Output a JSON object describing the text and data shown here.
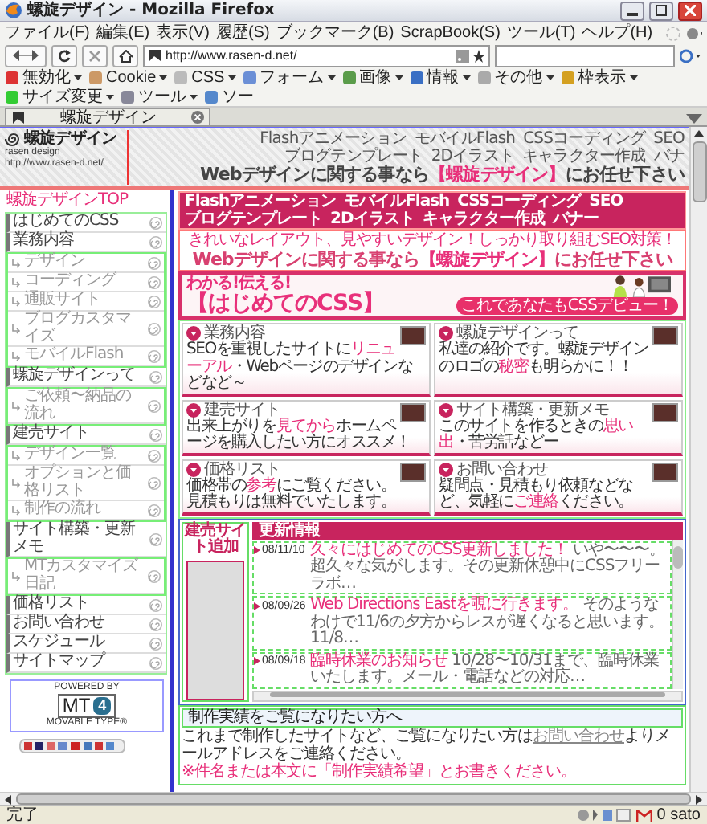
{
  "window": {
    "title": "螺旋デザイン - Mozilla Firefox"
  },
  "menu_bar": [
    "ファイル(F)",
    "編集(E)",
    "表示(V)",
    "履歴(S)",
    "ブックマーク(B)",
    "ScrapBook(S)",
    "ツール(T)",
    "ヘルプ(H)"
  ],
  "nav_toolbar": {
    "url": "http://www.rasen-d.net/"
  },
  "webdev_toolbar": [
    "無効化",
    "Cookie",
    "CSS",
    "フォーム",
    "画像",
    "情報",
    "その他",
    "枠表示",
    "サイズ変更",
    "ツール",
    "ソー"
  ],
  "tabs": [
    {
      "label": "螺旋デザイン",
      "selected": true
    }
  ],
  "site_header": {
    "logo": "螺旋デザイン",
    "logo_sub": "rasen design",
    "logo_url": "http://www.rasen-d.net/",
    "nav": [
      "Flashアニメーション",
      "モバイルFlash",
      "CSSコーディング",
      "SEO",
      "ブログテンプレート",
      "2Dイラスト",
      "キャラクター作成",
      "バナ"
    ],
    "tagline": [
      {
        "kind": "plain",
        "text": "Webデザインに関する事なら"
      },
      {
        "kind": "highlight",
        "text": "【螺旋デザイン】"
      },
      {
        "kind": "plain",
        "text": "にお任せ下さい"
      }
    ]
  },
  "breadcrumb": "螺旋デザインTOP",
  "sidebar": {
    "items": [
      {
        "label": "はじめてのCSS"
      },
      {
        "label": "業務内容",
        "children": [
          {
            "label": "デザイン"
          },
          {
            "label": "コーディング"
          },
          {
            "label": "通販サイト"
          },
          {
            "label": "ブログカスタマイズ"
          },
          {
            "label": "モバイルFlash"
          }
        ]
      },
      {
        "label": "螺旋デザインって",
        "children": [
          {
            "label": "ご依頼〜納品の流れ"
          }
        ]
      },
      {
        "label": "建売サイト",
        "children": [
          {
            "label": "デザイン一覧"
          },
          {
            "label": "オプションと価格リスト"
          },
          {
            "label": "制作の流れ"
          }
        ]
      },
      {
        "label": "サイト構築・更新メモ",
        "children": [
          {
            "label": "MTカスタマイズ日記"
          }
        ]
      },
      {
        "label": "価格リスト"
      },
      {
        "label": "お問い合わせ"
      },
      {
        "label": "スケジュール"
      },
      {
        "label": "サイトマップ"
      }
    ]
  },
  "powered_by": {
    "top": "POWERED BY",
    "mark": "MT",
    "version": "4",
    "bottom": "MOVABLE TYPE®"
  },
  "main": {
    "category_nav": [
      "Flashアニメーション",
      "モバイルFlash",
      "CSSコーディング",
      "SEO",
      "ブログテンプレート",
      "2Dイラスト",
      "キャラクター作成",
      "バナー"
    ],
    "banner": {
      "line1": "きれいなレイアウト、見やすいデザイン！しっかり取り組むSEO対策！",
      "line2": [
        {
          "kind": "plain",
          "text": "Webデザインに関する事なら"
        },
        {
          "kind": "highlight",
          "text": "【螺旋デザイン】"
        },
        {
          "kind": "plain",
          "text": "にお任せ下さい"
        }
      ]
    },
    "feature": {
      "kicker": "わかる!伝える!",
      "title": "【はじめてのCSS】",
      "link": "これであなたもCSSデビュー！"
    },
    "cards": [
      {
        "title": "業務内容",
        "text": [
          {
            "kind": "plain",
            "text": "SEOを重視したサイトに"
          },
          {
            "kind": "highlight",
            "text": "リニューアル"
          },
          {
            "kind": "plain",
            "text": "・Webページのデザインなどなど～"
          }
        ]
      },
      {
        "title": "螺旋デザインって",
        "text": [
          {
            "kind": "plain",
            "text": "私達の紹介です。螺旋デザインのロゴの"
          },
          {
            "kind": "highlight",
            "text": "秘密"
          },
          {
            "kind": "plain",
            "text": "も明らかに！！"
          }
        ]
      },
      {
        "title": "建売サイト",
        "text": [
          {
            "kind": "plain",
            "text": "出来上がりを"
          },
          {
            "kind": "highlight",
            "text": "見てから"
          },
          {
            "kind": "plain",
            "text": "ホームページを購入したい方にオススメ！"
          }
        ]
      },
      {
        "title": "サイト構築・更新メモ",
        "text": [
          {
            "kind": "plain",
            "text": "このサイトを作るときの"
          },
          {
            "kind": "highlight",
            "text": "思い出"
          },
          {
            "kind": "plain",
            "text": "・苦労話などー"
          }
        ]
      },
      {
        "title": "価格リスト",
        "text": [
          {
            "kind": "plain",
            "text": "価格帯の"
          },
          {
            "kind": "highlight",
            "text": "参考"
          },
          {
            "kind": "plain",
            "text": "にご覧ください。見積もりは無料でいたします。"
          }
        ]
      },
      {
        "title": "お問い合わせ",
        "text": [
          {
            "kind": "plain",
            "text": "疑問点・見積もり依頼などなど、気軽に"
          },
          {
            "kind": "highlight",
            "text": "ご連絡"
          },
          {
            "kind": "plain",
            "text": "ください。"
          }
        ]
      }
    ],
    "sale_site": {
      "title": "建売サイト追加"
    },
    "news": {
      "title": "更新情報",
      "items": [
        {
          "date": "08/11/10",
          "title": "久々にはじめてのCSS更新しました！",
          "text": "いや〜〜〜。超久々な気がします。その更新休憩中にCSSフリーラボ…"
        },
        {
          "date": "08/09/26",
          "title": "Web Directions Eastを覗に行きます。",
          "text": "そのようなわけで11/6の夕方からレスが遅くなると思います。11/8…"
        },
        {
          "date": "08/09/18",
          "title": "臨時休業のお知らせ",
          "text": "10/28〜10/31まで、臨時休業いたします。メール・電話などの対応…"
        }
      ]
    },
    "works": {
      "heading": "制作実績をご覧になりたい方へ",
      "text": [
        {
          "kind": "plain",
          "text": "これまで制作したサイトなど、ご覧になりたい方は"
        },
        {
          "kind": "link",
          "text": "お問い合わせ"
        },
        {
          "kind": "plain",
          "text": "よりメールアドレスをご連絡ください。"
        }
      ],
      "note": "※件名または本文に「制作実績希望」とお書きください。"
    }
  },
  "status_bar": {
    "text": "完了",
    "user": "0 sato"
  }
}
